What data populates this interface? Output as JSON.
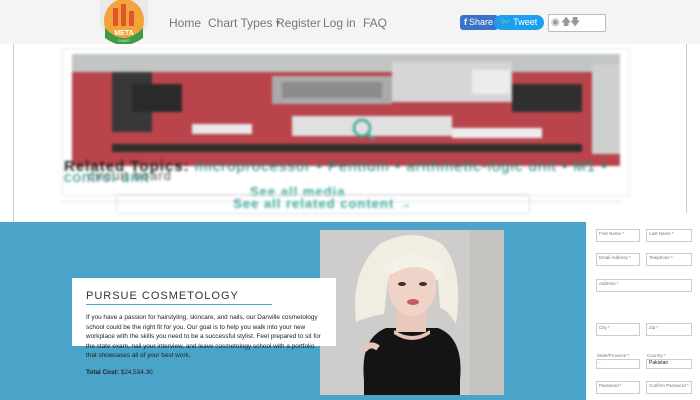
{
  "nav": {
    "logo_text": "META",
    "logo_subtext": "CHART",
    "items": [
      {
        "label": "Home"
      },
      {
        "label": "Chart Types"
      },
      {
        "label": "Register"
      },
      {
        "label": "Log in"
      },
      {
        "label": "FAQ"
      }
    ],
    "share_label": "Share",
    "tweet_label": "Tweet"
  },
  "article": {
    "caption": "circuit board",
    "see_all_media": "See all media",
    "related_label": "Related Topics:",
    "related_topics": "microprocessor • Pentium • arithmetic-logic unit • M1 • control unit",
    "see_related": "See all related content →"
  },
  "promo": {
    "title": "PURSUE COSMETOLOGY",
    "body": "If you have a passion for hairstyling, skincare, and nails, our Danville cosmetology school could be the right fit for you. Our goal is to help you walk into your new workplace with the skills you need to be a successful stylist. Feel prepared to sit for the state exam, nail your interview, and leave cosmetology school with a portfolio that showcases all of your best work.",
    "total_label": "Total Cost:",
    "total_value": "$24,534.30"
  },
  "form": {
    "fields": [
      {
        "label": "First Name *"
      },
      {
        "label": "Last Name *"
      },
      {
        "label": "Email Address *"
      },
      {
        "label": "Telephone *"
      },
      {
        "label": "Address *"
      },
      {
        "label": "City *"
      },
      {
        "label": "Zip *"
      },
      {
        "label": "State/Province *"
      },
      {
        "label": "Country *"
      },
      {
        "label": "Password *"
      },
      {
        "label": "Confirm Password *"
      }
    ],
    "state_value": "-",
    "country_value": "Pakistan"
  },
  "colors": {
    "banner": "#4aa3c9",
    "accent": "#3aa99b",
    "facebook": "#3b72c8",
    "twitter": "#1d9ff0"
  }
}
